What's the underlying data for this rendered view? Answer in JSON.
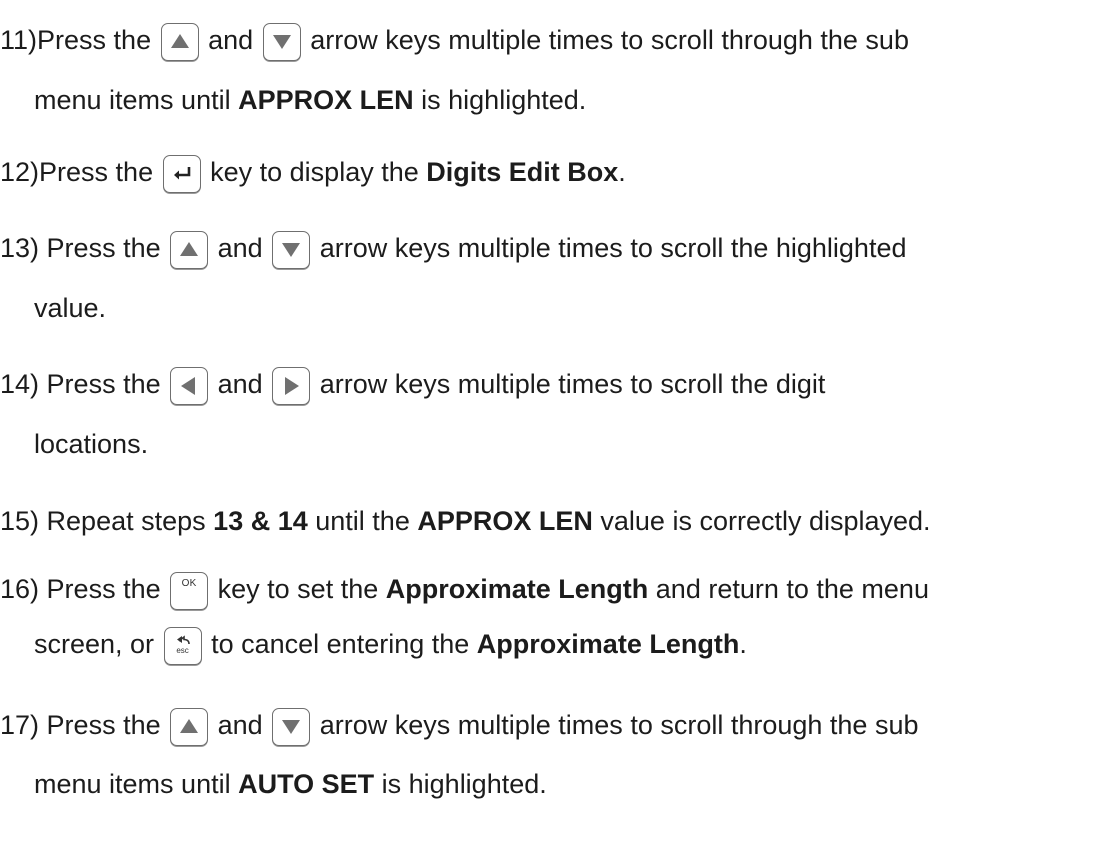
{
  "steps": [
    {
      "num": "11)",
      "press": "Press the",
      "and": "and",
      "rest": "arrow keys multiple times to scroll through the sub",
      "cont_pre": "menu items until",
      "cont_bold": "APPROX LEN",
      "cont_post": "is highlighted."
    },
    {
      "num": "12)",
      "press": "Press the",
      "rest_pre": "key to display the",
      "rest_bold": "Digits Edit Box",
      "rest_post": "."
    },
    {
      "num": "13)",
      "press": "Press the",
      "and": "and",
      "rest": "arrow keys multiple times to scroll the highlighted",
      "cont": "value."
    },
    {
      "num": "14)",
      "press": "Press the",
      "and": "and",
      "rest": "arrow keys multiple times to scroll the digit",
      "cont": "locations."
    },
    {
      "num": "15)",
      "pre": "Repeat steps",
      "bold1": "13 & 14",
      "mid": "until the",
      "bold2": "APPROX LEN",
      "post": "value is correctly displayed."
    },
    {
      "num": "16)",
      "press": "Press the",
      "rest_pre": "key to set the",
      "rest_bold": "Approximate Length",
      "rest_post": "and return to the menu",
      "cont_pre": "screen, or",
      "cont_mid": "to cancel entering the",
      "cont_bold": "Approximate Length",
      "cont_post": "."
    },
    {
      "num": "17)",
      "press": "Press the",
      "and": "and",
      "rest": "arrow keys multiple times to scroll through the sub",
      "cont_pre": "menu items until",
      "cont_bold": "AUTO SET",
      "cont_post": "is highlighted."
    }
  ],
  "keys": {
    "ok_label": "OK",
    "esc_label": "esc"
  },
  "icons": [
    "up-arrow-icon",
    "down-arrow-icon",
    "left-arrow-icon",
    "right-arrow-icon",
    "enter-icon",
    "ok-icon",
    "esc-icon"
  ]
}
